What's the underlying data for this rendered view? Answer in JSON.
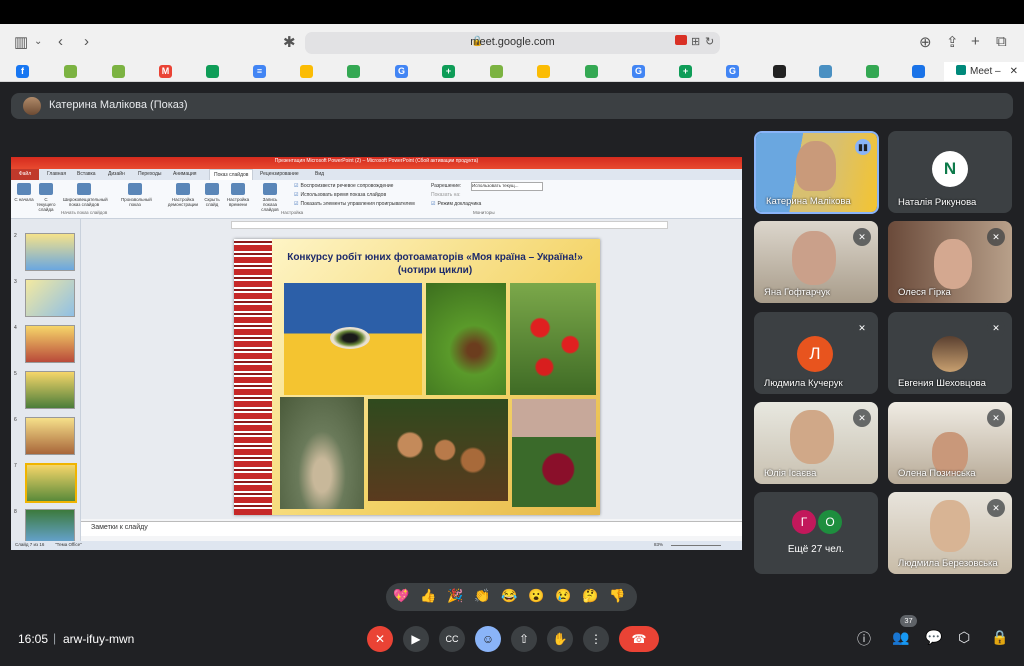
{
  "browser": {
    "url": "meet.google.com",
    "active_tab_title": "Meet –"
  },
  "meeting": {
    "presenter_label": "Катерина Малікова (Показ)",
    "time": "16:05",
    "separator": "|",
    "code": "arw-ifuy-mwn",
    "participants_count": "37"
  },
  "powerpoint": {
    "window_title": "Презентация Microsoft PowerPoint (2) – Microsoft PowerPoint (Сбой активации продукта)",
    "file_tab": "Файл",
    "tabs": [
      "Главная",
      "Вставка",
      "Дизайн",
      "Переходы",
      "Анимация",
      "Показ слайдов",
      "Рецензирование",
      "Вид"
    ],
    "ribbon_buttons": [
      "С начала",
      "С текущего слайда",
      "Широковещательный показ слайдов",
      "Произвольный показ",
      "Настройка демонстрации",
      "Скрыть слайд",
      "Настройка времени",
      "Запись показа слайдов"
    ],
    "group_start": "Начать показ слайдов",
    "group_setup": "Настройка",
    "group_monitors": "Мониторы",
    "checks": [
      "Воспроизвести речевое сопровождение",
      "Использовать время показа слайдов",
      "Показать элементы управления проигрывателем"
    ],
    "resolution_label": "Разрешение:",
    "resolution_value": "Использовать текущ...",
    "show_on_label": "Показать на:",
    "presenter_view": "Режим докладчика",
    "thumb_numbers": [
      "2",
      "3",
      "4",
      "5",
      "6",
      "7",
      "8"
    ],
    "slide_title": "Конкурсу робіт юних фотоаматорів «Моя країна – Україна!» (чотири цикли)",
    "notes_placeholder": "Заметки к слайду",
    "status_slide": "Слайд 7 из 16",
    "status_theme": "\"Тема Office\"",
    "zoom": "83%"
  },
  "participants": [
    {
      "name": "Катерина Малікова"
    },
    {
      "name": "Наталія Рикунова",
      "initial": "N"
    },
    {
      "name": "Яна Гофтарчук"
    },
    {
      "name": "Олеся Гірка"
    },
    {
      "name": "Людмила Кучерук",
      "initial": "Л"
    },
    {
      "name": "Евгения Шеховцова"
    },
    {
      "name": "Юлія Ісаєва"
    },
    {
      "name": "Олена Позинська"
    },
    {
      "name": "Ещё 27 чел.",
      "initials": [
        "Г",
        "О"
      ]
    },
    {
      "name": "Людмила Березовська"
    }
  ],
  "colors": {
    "meet_bg": "#202124",
    "tile_bg": "#3c4043",
    "red": "#ea4335",
    "blue": "#8ab4f8",
    "avatar_orange": "#e8541e",
    "avatar_pink": "#c2185b",
    "avatar_green": "#1e8e3e"
  },
  "reactions": [
    "💖",
    "👍",
    "🎉",
    "👏",
    "😂",
    "😮",
    "😢",
    "🤔",
    "👎"
  ]
}
